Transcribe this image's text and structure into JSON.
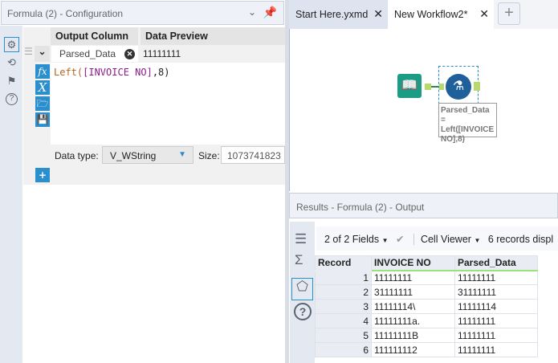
{
  "config": {
    "title": "Formula (2) - Configuration",
    "col_output": "Output Column",
    "col_preview": "Data Preview",
    "output_name": "Parsed_Data",
    "preview_value": "11111111",
    "expression": {
      "func": "Left(",
      "field": "[INVOICE NO]",
      "rest": ",8)"
    },
    "data_type_label": "Data type:",
    "data_type": "V_WString",
    "size_label": "Size:",
    "size": "1073741823"
  },
  "tabs": [
    {
      "label": "Start Here.yxmd"
    },
    {
      "label": "New Workflow2*"
    }
  ],
  "canvas": {
    "annotation": "Parsed_Data = Left([INVOICE NO],8)"
  },
  "results": {
    "title": "Results - Formula (2) - Output",
    "fields": "2 of 2 Fields",
    "viewer": "Cell Viewer",
    "records": "6 records displ",
    "columns": [
      "Record",
      "INVOICE NO",
      "Parsed_Data"
    ],
    "rows": [
      [
        "1",
        "11111111",
        "11111111"
      ],
      [
        "2",
        "31111111",
        "31111111"
      ],
      [
        "3",
        "11111114\\",
        "11111114"
      ],
      [
        "4",
        "11111111a.",
        "11111111"
      ],
      [
        "5",
        "11111111B",
        "11111111"
      ],
      [
        "6",
        "111111112",
        "11111111"
      ]
    ]
  }
}
